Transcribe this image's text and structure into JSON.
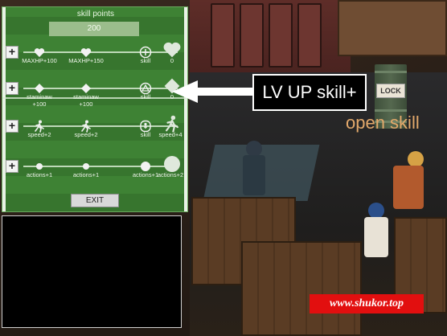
{
  "skill_panel": {
    "title": "skill points",
    "points_value": "200",
    "rows": [
      {
        "nodes": [
          {
            "label": "MAXHP+100",
            "icon": "heart-icon"
          },
          {
            "label": "MAXHP+150",
            "icon": "heart-icon"
          },
          {
            "label": "skill",
            "icon": "plus-circle-icon"
          },
          {
            "label": "0",
            "icon": "big-heart-icon"
          }
        ]
      },
      {
        "nodes": [
          {
            "label": "staminaw\n+100",
            "icon": "diamond-icon"
          },
          {
            "label": "staminaw\n+100",
            "icon": "diamond-icon"
          },
          {
            "label": "skill",
            "icon": "triangle-circle-icon"
          },
          {
            "label": "0",
            "icon": "big-diamond-icon"
          }
        ]
      },
      {
        "nodes": [
          {
            "label": "speed+2",
            "icon": "running-person-icon"
          },
          {
            "label": "speed+2",
            "icon": "running-person-icon"
          },
          {
            "label": "skill",
            "icon": "person-circle-icon"
          },
          {
            "label": "speed+4",
            "icon": "big-running-person-icon"
          }
        ]
      },
      {
        "nodes": [
          {
            "label": "actions+1",
            "icon": "dot-icon"
          },
          {
            "label": "actions+1",
            "icon": "dot-icon"
          },
          {
            "label": "actions+1",
            "icon": "dot-icon"
          },
          {
            "label": "actions+2",
            "icon": "big-dot-icon"
          }
        ]
      }
    ],
    "plus_label": "+",
    "exit_label": "EXIT"
  },
  "callout": {
    "text": "LV UP skill+"
  },
  "lock_sign": "LOCK",
  "open_skill_text": "open skill",
  "watermark": "www.shukor.top",
  "colors": {
    "panel_green": "#3e8234",
    "callout_bg": "#000000",
    "open_skill": "#e3a96b",
    "watermark_bg": "#e20f0f"
  }
}
